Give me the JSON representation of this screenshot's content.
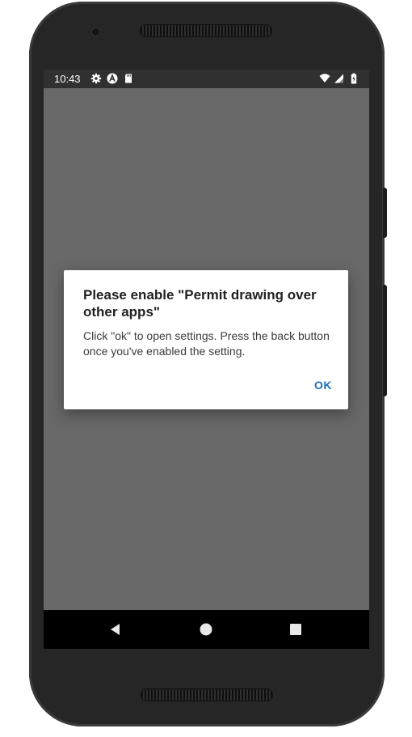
{
  "status_bar": {
    "time": "10:43",
    "left_icons": [
      "gear-icon",
      "a-circle-icon",
      "sd-card-icon"
    ],
    "right_icons": [
      "wifi-icon",
      "signal-icon",
      "battery-charging-icon"
    ]
  },
  "dialog": {
    "title": "Please enable \"Permit drawing over other apps\"",
    "message": "Click \"ok\" to open settings. Press the back button once you've enabled the setting.",
    "ok_label": "OK",
    "accent_color": "#1e6fb8"
  },
  "navigation_bar": {
    "buttons": [
      "back-icon",
      "home-icon",
      "recents-icon"
    ]
  }
}
